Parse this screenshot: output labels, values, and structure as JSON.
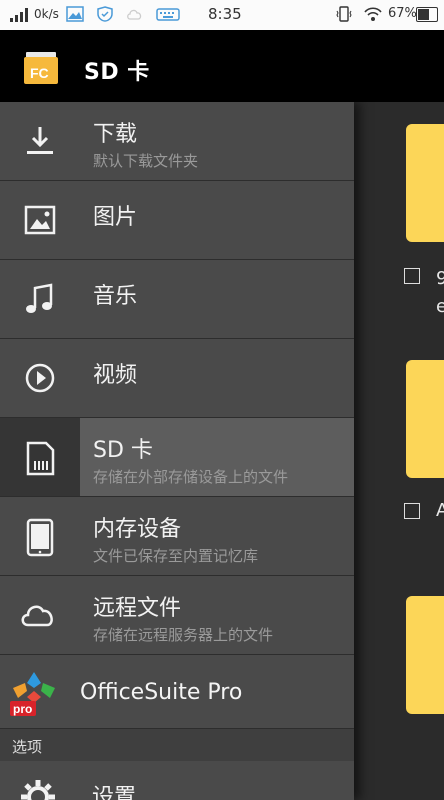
{
  "status_bar": {
    "speed": "0k/s",
    "time": "8:35",
    "battery": "67%",
    "battery_level": 0.67
  },
  "app": {
    "title": "SD 卡",
    "logo_text": "FC"
  },
  "drawer": {
    "items": [
      {
        "label": "下载",
        "sub": "默认下载文件夹",
        "icon": "download-icon"
      },
      {
        "label": "图片",
        "sub": "",
        "icon": "image-icon"
      },
      {
        "label": "音乐",
        "sub": "",
        "icon": "music-icon"
      },
      {
        "label": "视频",
        "sub": "",
        "icon": "video-icon"
      },
      {
        "label": "SD 卡",
        "sub": "存储在外部存储设备上的文件",
        "icon": "sd-card-icon",
        "selected": true
      },
      {
        "label": "内存设备",
        "sub": "文件已保存至内置记忆库",
        "icon": "tablet-icon"
      },
      {
        "label": "远程文件",
        "sub": "存储在远程服务器上的文件",
        "icon": "cloud-icon"
      }
    ],
    "officesuite": {
      "label": "OfficeSuite Pro",
      "badge": "pro"
    },
    "section_title": "选项",
    "settings_label": "设置"
  },
  "content": {
    "rows": [
      {
        "text": "9\ne"
      },
      {
        "text": "A"
      }
    ]
  },
  "colors": {
    "accent": "#fcd658",
    "drawer_bg": "#4a4a4a",
    "header_bg": "#000000"
  }
}
